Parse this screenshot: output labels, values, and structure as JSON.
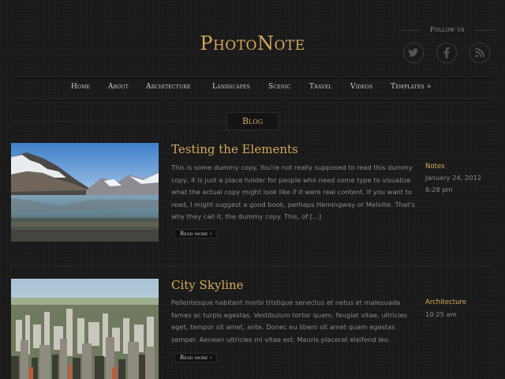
{
  "site": {
    "title": "PhotoNote"
  },
  "social": {
    "follow_label": "Follow us",
    "icons": [
      {
        "name": "twitter-icon",
        "glyph": "t"
      },
      {
        "name": "facebook-icon",
        "glyph": "f"
      },
      {
        "name": "rss-icon",
        "glyph": "rss"
      }
    ]
  },
  "nav": {
    "items": [
      {
        "label": "Home"
      },
      {
        "label": "About"
      },
      {
        "label": "Architecture"
      },
      {
        "label": "Landscapes"
      },
      {
        "label": "Scenic"
      },
      {
        "label": "Travel"
      },
      {
        "label": "Videos"
      },
      {
        "label": "Templates »"
      }
    ]
  },
  "section_tab": {
    "label": "Blog"
  },
  "posts": [
    {
      "title": "Testing the Elements",
      "excerpt": "This is some dummy copy. You're not really supposed to read this dummy copy, it is just a place holder for people who need some type to visualize what the actual copy might look like if it were real content. If you want to read, I might suggest a good book, perhaps Hemingway or Melville. That's why they call it, the dummy copy. This, of [...]",
      "read_more": "Read more ›",
      "category": "Notes",
      "date": "January 24, 2012 6:28 pm",
      "image": "mountain-lake-photo"
    },
    {
      "title": "City Skyline",
      "excerpt": "Pellentesque habitant morbi tristique senectus et netus et malesuada fames ac turpis egestas. Vestibulum tortor quam, feugiat vitae, ultricies eget, tempor sit amet, ante. Donec eu libero sit amet quam egestas semper. Aenean ultricies mi vitae est. Mauris placerat eleifend leo.",
      "read_more": "Read more ›",
      "category": "Architecture",
      "date": "10:25 am",
      "image": "city-skyline-photo"
    }
  ],
  "colors": {
    "accent": "#d6a95c",
    "background": "#1b1b1b",
    "text": "#8a8a8a"
  }
}
